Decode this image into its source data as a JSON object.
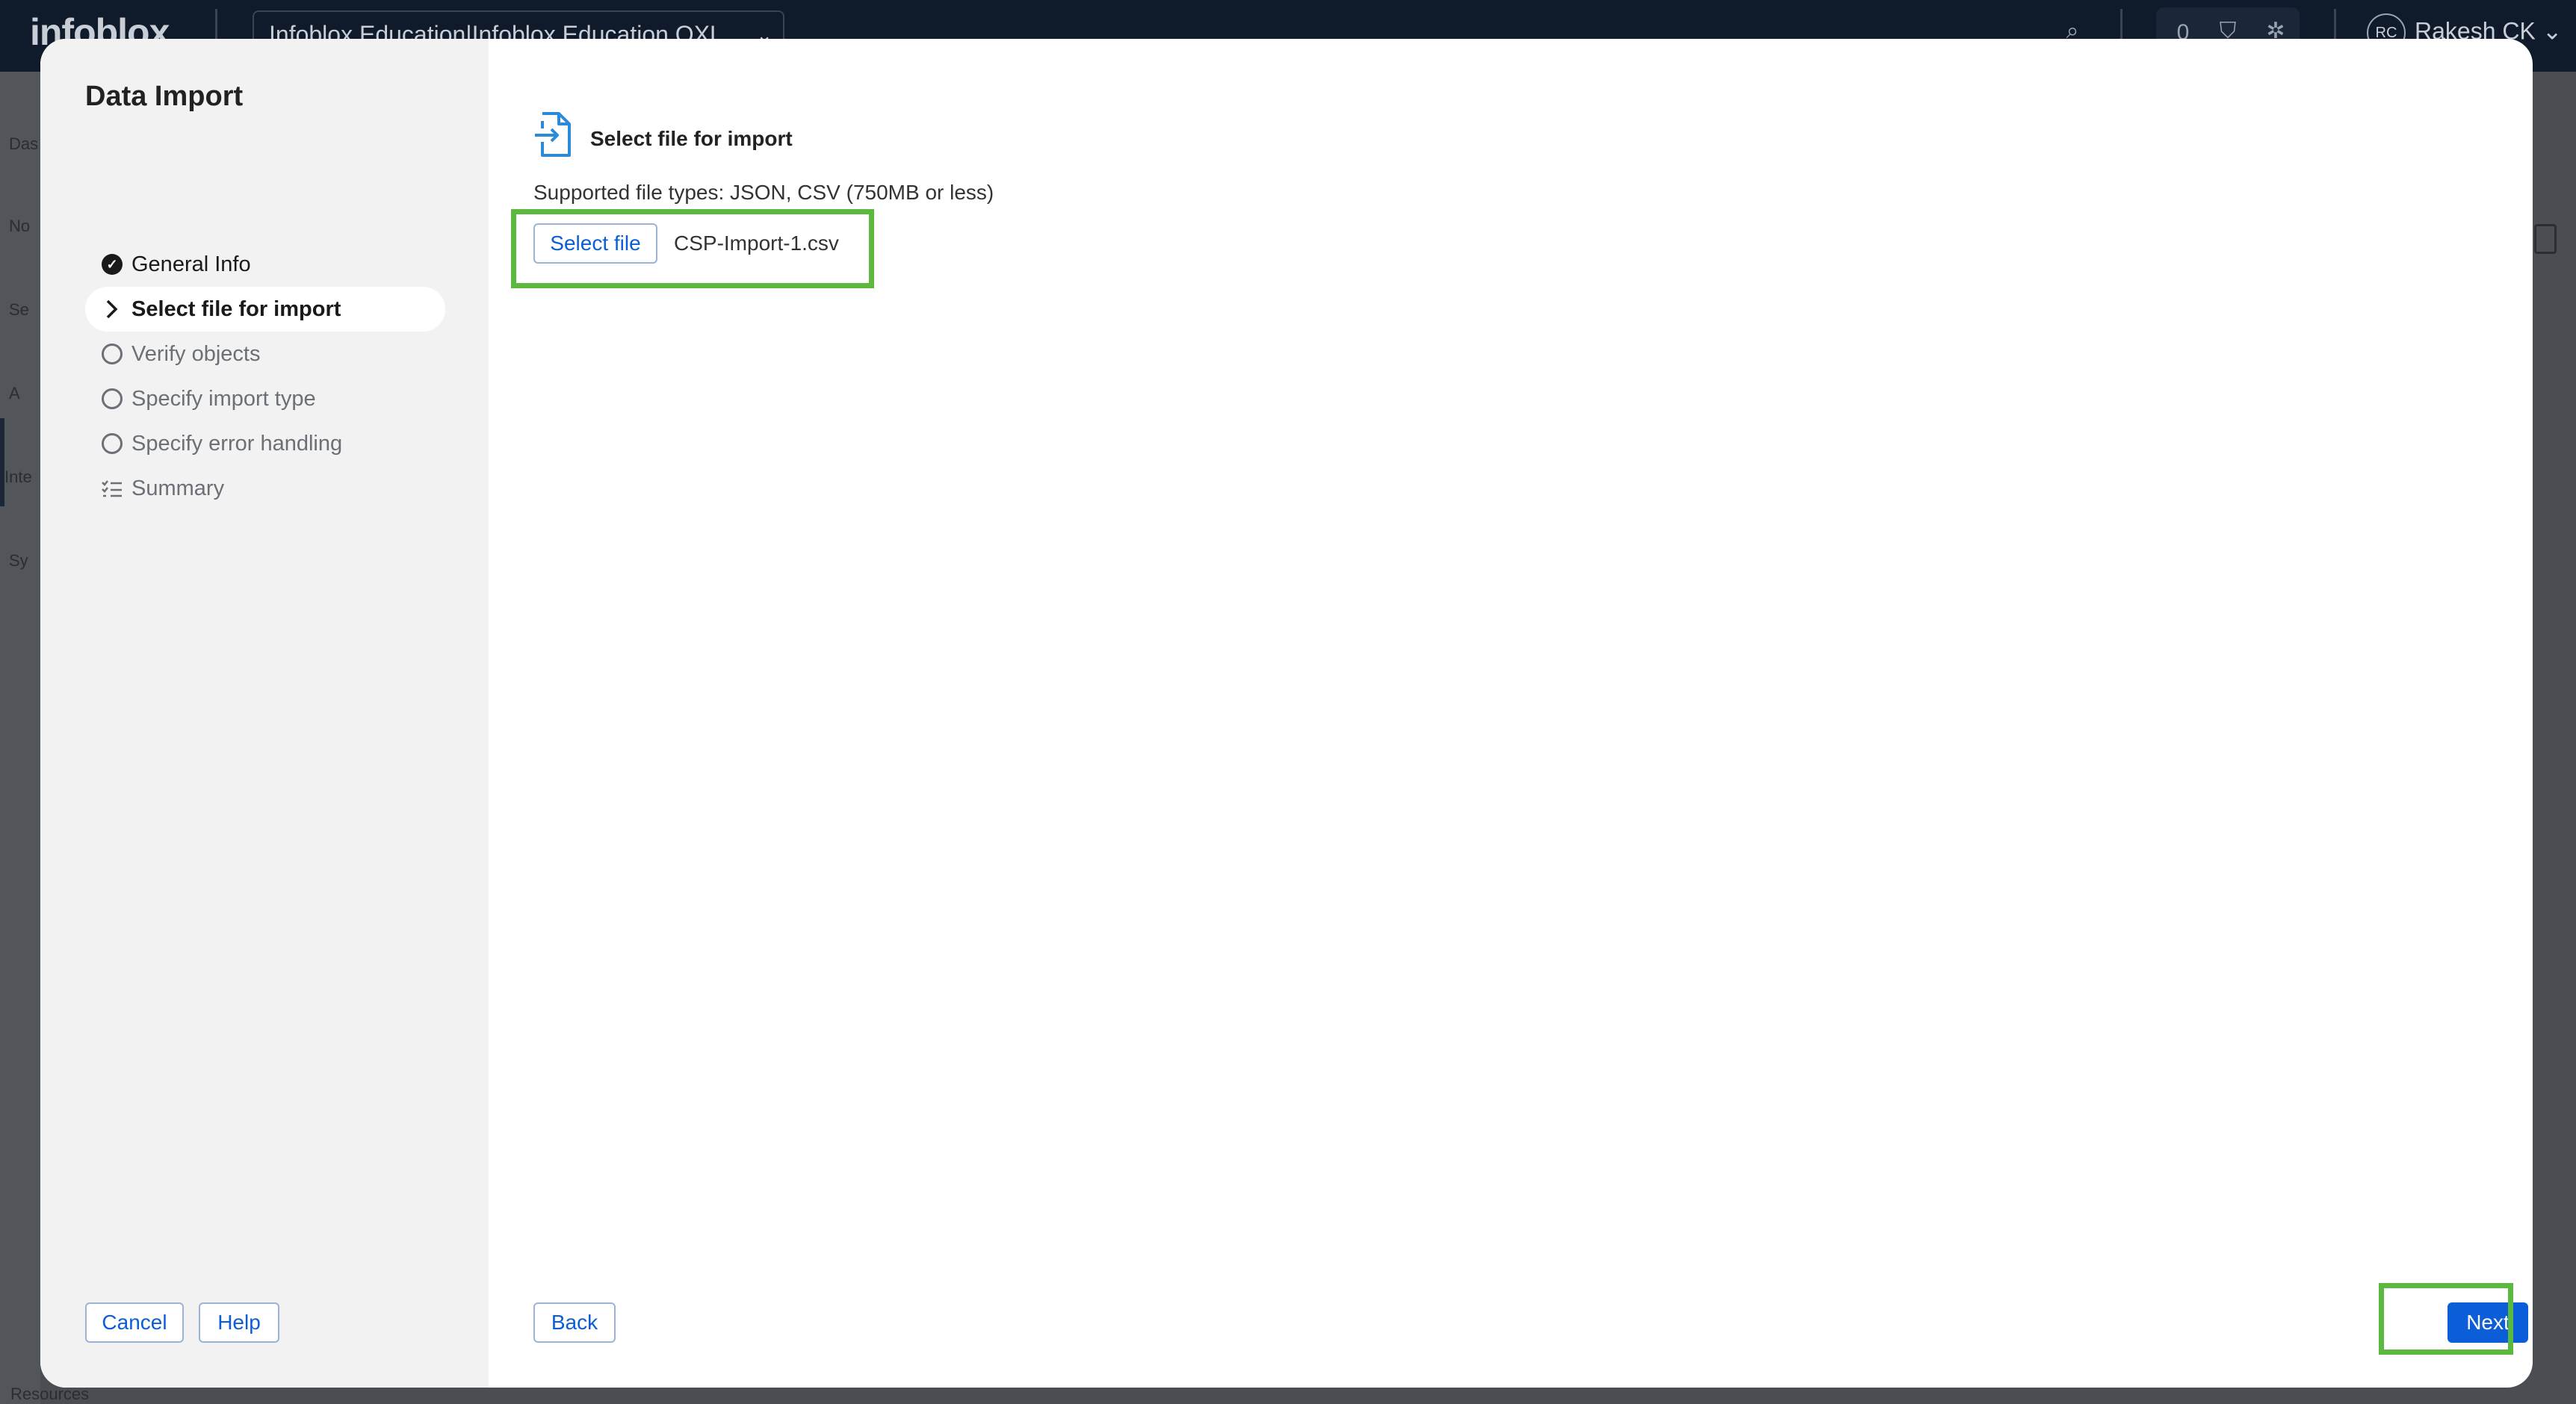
{
  "background": {
    "logo": "infoblox",
    "account_selector": "Infoblox Education|Infoblox Education OXL",
    "notification_count": "0",
    "user_initials": "RC",
    "user_name": "Rakesh CK",
    "sidebar_fragments": [
      "Das",
      "No",
      "Se",
      "A",
      "Inte",
      "Sy"
    ],
    "resources_label": "Resources"
  },
  "modal": {
    "title": "Data Import",
    "steps": [
      {
        "label": "General Info",
        "state": "done",
        "icon": "check-circle-icon"
      },
      {
        "label": "Select file for import",
        "state": "active",
        "icon": "chevron-right-icon"
      },
      {
        "label": "Verify objects",
        "state": "pending",
        "icon": "circle-icon"
      },
      {
        "label": "Specify import type",
        "state": "pending",
        "icon": "circle-icon"
      },
      {
        "label": "Specify error handling",
        "state": "pending",
        "icon": "circle-icon"
      },
      {
        "label": "Summary",
        "state": "pending",
        "icon": "list-icon"
      }
    ],
    "cancel_label": "Cancel",
    "help_label": "Help",
    "section_title": "Select file for import",
    "supported_types": "Supported file types: JSON, CSV (750MB or less)",
    "select_file_label": "Select file",
    "file_name": "CSP-Import-1.csv",
    "back_label": "Back",
    "next_label": "Next"
  },
  "colors": {
    "primary": "#0b5ed7",
    "highlight": "#5cb940",
    "sidebar_bg": "#f2f2f3",
    "topbar_bg": "#0f1a2b"
  }
}
